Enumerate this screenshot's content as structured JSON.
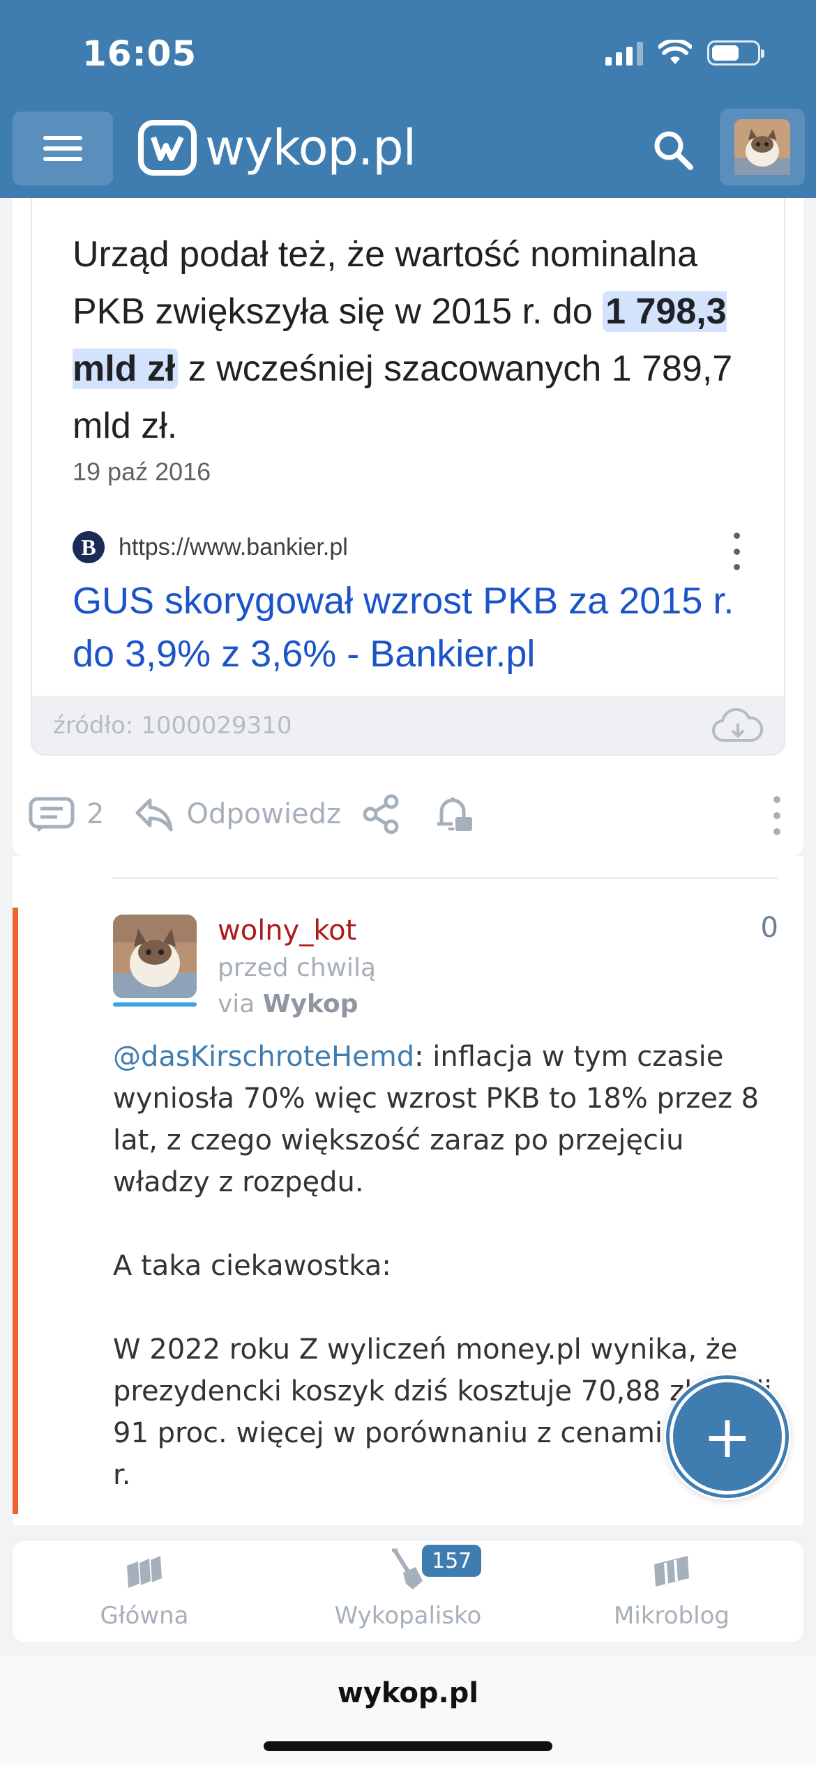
{
  "status_bar": {
    "time": "16:05"
  },
  "header": {
    "logo_text": "wykop.pl"
  },
  "link_preview": {
    "body_before": "Urząd podał też, że wartość nominalna PKB zwiększyła się w 2015 r. do ",
    "body_highlight": "1 798,3 mld zł",
    "body_after": " z wcześniej szacowanych 1 789,7 mld zł.",
    "date": "19 paź 2016",
    "site_letter": "B",
    "site_url": "https://www.bankier.pl",
    "result_title": "GUS skorygował wzrost PKB za 2015 r. do 3,9% z 3,6% - Bankier.pl",
    "source_label": "źródło: 1000029310"
  },
  "actions": {
    "comments_count": "2",
    "reply_label": "Odpowiedz"
  },
  "reply": {
    "username": "wolny_kot",
    "time": "przed chwilą",
    "via_prefix": "via",
    "via_app": "Wykop",
    "score": "0",
    "mention": "@dasKirschroteHemd",
    "paragraph1": ": inflacja w tym czasie wyniosła 70% więc wzrost PKB to 18% przez 8 lat, z czego większość zaraz po przejęciu władzy z rozpędu.",
    "paragraph2": "A taka ciekawostka:",
    "paragraph3": "W 2022 roku Z wyliczeń money.pl wynika, że prezydencki koszyk dziś kosztuje 70,88 zł, czyli 91 proc. więcej w porównaniu z cenami z 2015 r."
  },
  "fab": {
    "label": "+"
  },
  "tabbar": {
    "tabs": [
      {
        "label": "Główna"
      },
      {
        "label": "Wykopalisko"
      },
      {
        "label": "Mikroblog"
      }
    ],
    "wykopalisko_badge": "157"
  },
  "browser": {
    "url": "wykop.pl"
  },
  "colors": {
    "brand": "#3f7cb0",
    "accent_orange": "#f0622d",
    "username": "#ad1b1b",
    "link": "#1a54c8"
  }
}
